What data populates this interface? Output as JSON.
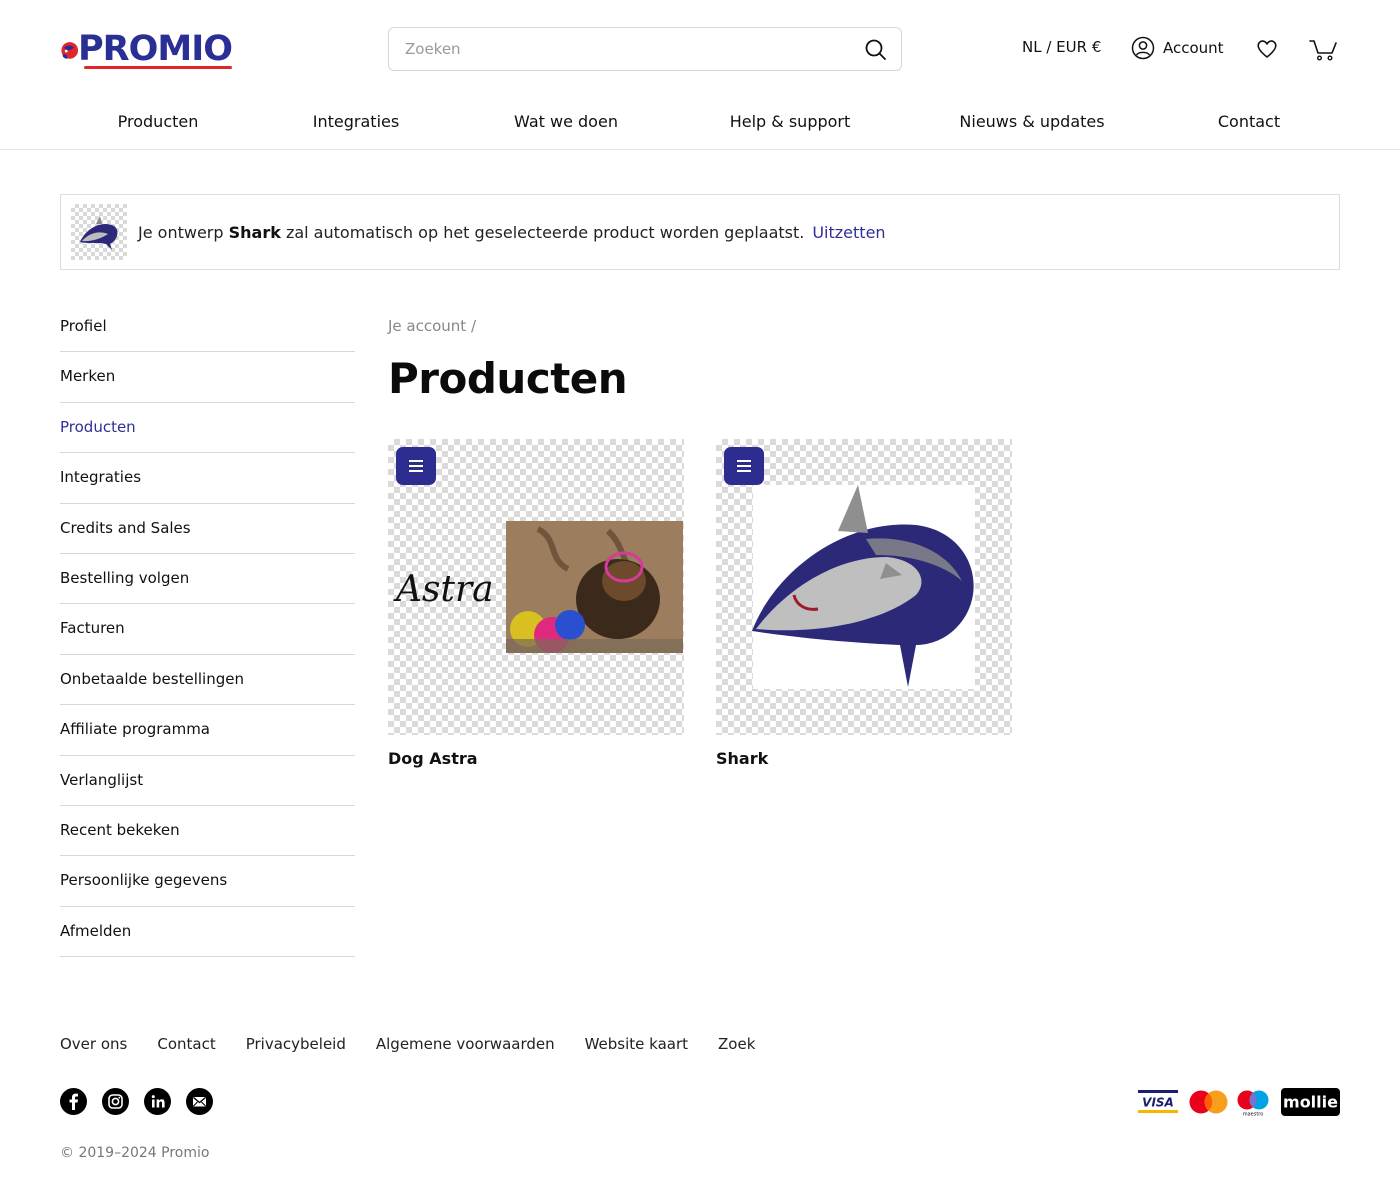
{
  "header": {
    "logo_text": "PROMIO",
    "search_placeholder": "Zoeken",
    "locale": "NL / EUR €",
    "account_label": "Account"
  },
  "main_nav": [
    "Producten",
    "Integraties",
    "Wat we doen",
    "Help & support",
    "Nieuws & updates",
    "Contact"
  ],
  "notice": {
    "text_before": "Je ontwerp ",
    "design_name": "Shark",
    "text_after": " zal automatisch op het geselecteerde product worden geplaatst.",
    "link": "Uitzetten"
  },
  "sidebar": {
    "items": [
      "Profiel",
      "Merken",
      "Producten",
      "Integraties",
      "Credits and Sales",
      "Bestelling volgen",
      "Facturen",
      "Onbetaalde bestellingen",
      "Affiliate programma",
      "Verlanglijst",
      "Recent bekeken",
      "Persoonlijke gegevens",
      "Afmelden"
    ],
    "active": "Producten"
  },
  "breadcrumb": {
    "root": "Je account",
    "separator": "/"
  },
  "page_title": "Producten",
  "products": [
    {
      "name": "Dog Astra",
      "image_text": "Astra"
    },
    {
      "name": "Shark"
    }
  ],
  "footer": {
    "links": [
      "Over ons",
      "Contact",
      "Privacybeleid",
      "Algemene voorwaarden",
      "Website kaart",
      "Zoek"
    ],
    "socials": [
      "facebook-icon",
      "instagram-icon",
      "linkedin-icon",
      "email-icon"
    ],
    "payments": {
      "visa": "VISA",
      "maestro": "maestro",
      "mollie": "mollie"
    },
    "copyright": "© 2019–2024 Promio"
  },
  "colors": {
    "brand_blue": "#2a2f95",
    "brand_red": "#e1252d",
    "link_blue": "#2f2f9a",
    "card_menu": "#2d2d8f"
  }
}
